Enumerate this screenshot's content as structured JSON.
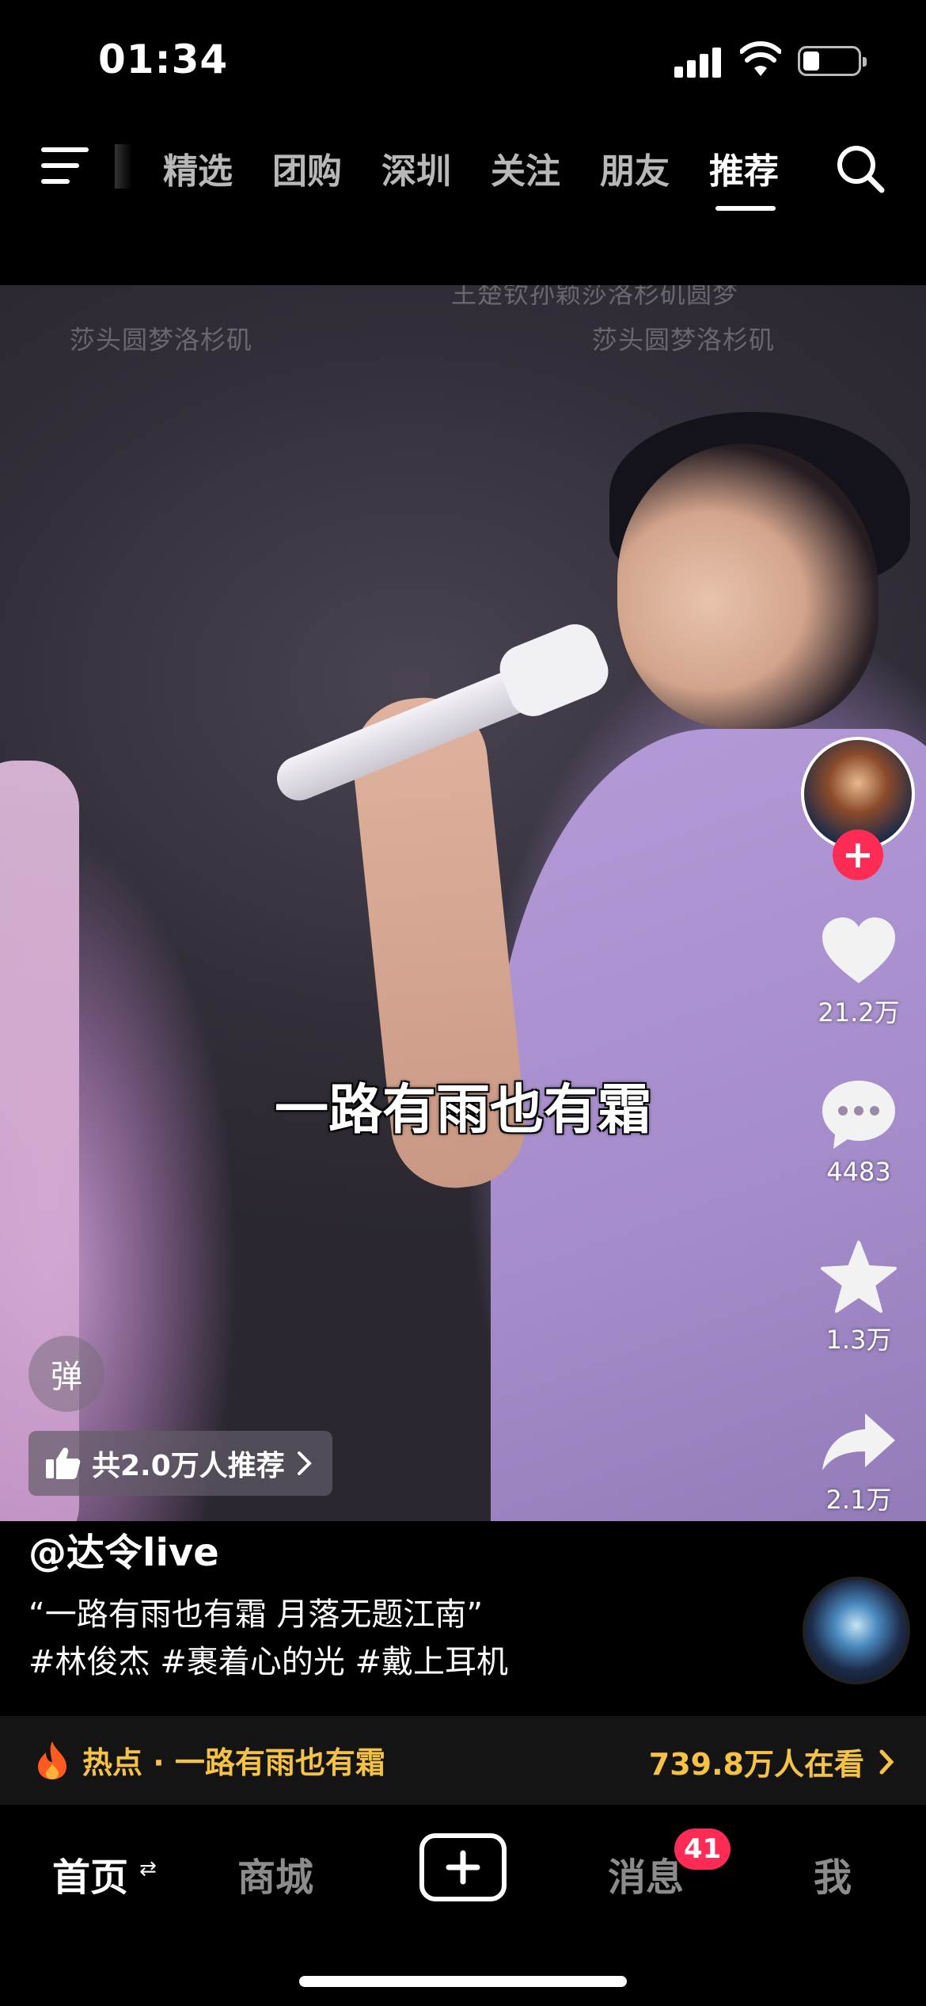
{
  "status_bar": {
    "time": "01:34"
  },
  "top_nav": {
    "tabs": [
      {
        "label": "精选",
        "active": false
      },
      {
        "label": "团购",
        "active": false
      },
      {
        "label": "深圳",
        "active": false
      },
      {
        "label": "关注",
        "active": false
      },
      {
        "label": "朋友",
        "active": false
      },
      {
        "label": "推荐",
        "active": true
      }
    ]
  },
  "video": {
    "watermarks": [
      "王楚钦孙颖莎洛杉矶圆梦",
      "莎头圆梦洛杉矶",
      "莎头圆梦洛杉矶"
    ],
    "subtitle": "一路有雨也有霜",
    "danmu_label": "弹",
    "recommend_text": "共2.0万人推荐"
  },
  "actions": {
    "like_count": "21.2万",
    "comment_count": "4483",
    "favorite_count": "1.3万",
    "share_count": "2.1万",
    "follow_symbol": "+"
  },
  "post": {
    "author": "@达令live",
    "caption": "“一路有雨也有霜 月落无题江南”",
    "hashtags": "#林俊杰 #裹着心的光 #戴上耳机"
  },
  "hot_bar": {
    "text": "热点 · 一路有雨也有霜",
    "viewers": "739.8万人在看"
  },
  "bottom_nav": {
    "home": "首页",
    "home_swap": "⇄",
    "mall": "商城",
    "messages": "消息",
    "messages_badge": "41",
    "me": "我"
  },
  "colors": {
    "accent_red": "#fe2c55",
    "hot_yellow": "#f5c245"
  }
}
